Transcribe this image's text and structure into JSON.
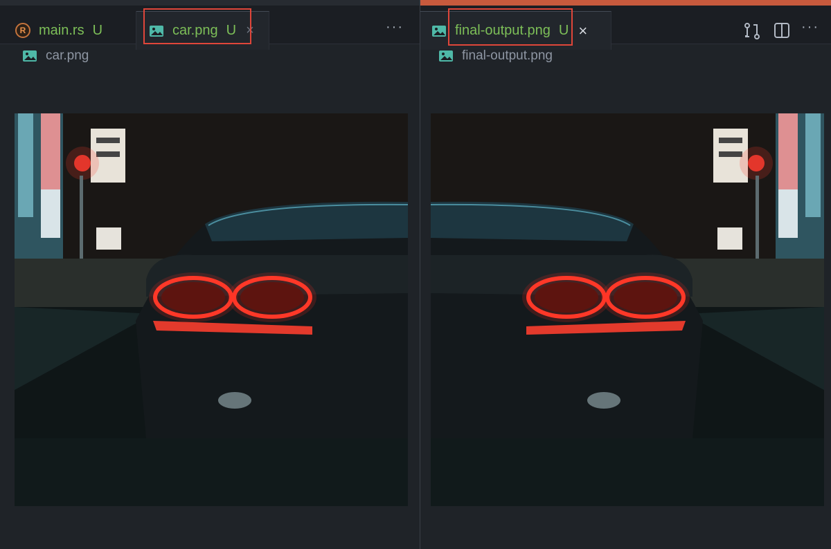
{
  "left_pane": {
    "tabs": [
      {
        "label": "main.rs",
        "badge": "U",
        "icon": "rust-file-icon"
      },
      {
        "label": "car.png",
        "badge": "U",
        "icon": "image-file-icon",
        "close": "×"
      }
    ],
    "more": "···",
    "breadcrumb": "car.png"
  },
  "right_pane": {
    "tabs": [
      {
        "label": "final-output.png",
        "badge": "U",
        "icon": "image-file-icon",
        "close": "×"
      }
    ],
    "more": "···",
    "breadcrumb": "final-output.png"
  },
  "icons": {
    "compare": "compare-changes-icon",
    "split": "split-editor-icon",
    "rust_glyph": "R"
  },
  "colors": {
    "modified_green": "#7dbf58",
    "highlight_red": "#e0463a",
    "image_icon": "#4fb9a8"
  }
}
